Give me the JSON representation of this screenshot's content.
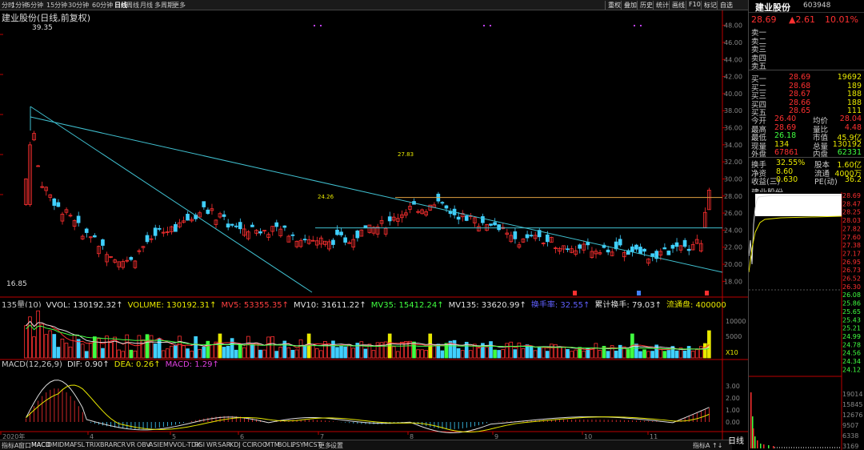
{
  "top_toolbar": {
    "items": [
      "分时",
      "1分钟",
      "5分钟",
      "15分钟",
      "30分钟",
      "60分钟",
      "日线",
      "周线",
      "月线",
      "多周期",
      "更多"
    ],
    "active": "日线",
    "right_items": [
      "重权",
      "叠加",
      "历史",
      "统计",
      "画线",
      "F10",
      "标记",
      "自选"
    ]
  },
  "chart_title": "建业股份(日线,前复权)",
  "main": {
    "high_label": "39.35",
    "low_label": "16.85",
    "price_ticks": [
      "48.00",
      "46.00",
      "44.00",
      "42.00",
      "40.00",
      "38.00",
      "36.00",
      "34.00",
      "32.00",
      "30.00",
      "28.00",
      "26.00",
      "24.00",
      "22.00",
      "20.00",
      "18.00"
    ],
    "annot_high": "27.83",
    "annot_low": "24.26",
    "markers": [
      "3",
      "3",
      "3"
    ]
  },
  "volume": {
    "legend": [
      {
        "t": "135量(10)",
        "c": "#c8c8c8"
      },
      {
        "t": "VVOL: 130192.32↑",
        "c": "#e0e0e0"
      },
      {
        "t": "VOLUME: 130192.31↑",
        "c": "#e8e800"
      },
      {
        "t": "MV5: 53355.35↑",
        "c": "#ff4040"
      },
      {
        "t": "MV10: 31611.22↑",
        "c": "#e0e0e0"
      },
      {
        "t": "MV35: 15412.24↑",
        "c": "#40ff40"
      },
      {
        "t": "MV135: 33620.99↑",
        "c": "#e0e0e0"
      },
      {
        "t": "换手率: 32.55↑",
        "c": "#6060ff"
      },
      {
        "t": "累计换手: 79.03↑",
        "c": "#e0e0e0"
      },
      {
        "t": "流通盘: 40000000.0",
        "c": "#e8e800"
      }
    ],
    "ticks": [
      "10000",
      "5000",
      "X10"
    ]
  },
  "macd": {
    "legend": [
      {
        "t": "MACD(12,26,9)",
        "c": "#c8c8c8"
      },
      {
        "t": "DIF: 0.90↑",
        "c": "#e0e0e0"
      },
      {
        "t": "DEA: 0.26↑",
        "c": "#e8e800"
      },
      {
        "t": "MACD: 1.29↑",
        "c": "#e040e0"
      }
    ],
    "ticks": [
      "3.00",
      "2.00",
      "1.00",
      "0.00"
    ]
  },
  "xaxis": {
    "labels": [
      "2020年",
      "4",
      "5",
      "6",
      "7",
      "8",
      "9",
      "10",
      "11"
    ]
  },
  "bottom_bar": {
    "items": [
      "指标A",
      "窗口",
      "MACD",
      "DMI",
      "DMA",
      "FSL",
      "TRIX",
      "BRAR",
      "CR",
      "VR",
      "OBV",
      "ASI",
      "EMV",
      "VOL-TDX",
      "RSI",
      "WR",
      "SAR",
      "KDJ",
      "CCI",
      "ROC",
      "MTM",
      "BOLL",
      "PSY",
      "MCST",
      "更多",
      "设置"
    ],
    "active": "MACD",
    "right": "指标A ↑↓"
  },
  "quote": {
    "name": "建业股份",
    "code": "603948",
    "price": "28.69",
    "change": "▲2.61",
    "pct": "10.01%",
    "asks": [
      {
        "l": "卖五",
        "p": "",
        "v": ""
      },
      {
        "l": "卖四",
        "p": "",
        "v": ""
      },
      {
        "l": "卖三",
        "p": "",
        "v": ""
      },
      {
        "l": "卖二",
        "p": "",
        "v": ""
      },
      {
        "l": "卖一",
        "p": "",
        "v": ""
      }
    ],
    "bids": [
      {
        "l": "买一",
        "p": "28.69",
        "v": "19692"
      },
      {
        "l": "买二",
        "p": "28.68",
        "v": "189"
      },
      {
        "l": "买三",
        "p": "28.67",
        "v": "188"
      },
      {
        "l": "买四",
        "p": "28.66",
        "v": "188"
      },
      {
        "l": "买五",
        "p": "28.65",
        "v": "111"
      }
    ],
    "stats": [
      [
        "今开",
        "26.40",
        "均价",
        "28.04"
      ],
      [
        "最高",
        "28.69",
        "量比",
        "4.48"
      ],
      [
        "最低",
        "26.18",
        "市值",
        "45.9亿"
      ],
      [
        "现量",
        "134",
        "总量",
        "130192"
      ],
      [
        "外盘",
        "67861",
        "内盘",
        "62331"
      ]
    ],
    "stats2": [
      [
        "换手",
        "32.55%",
        "股本",
        "1.60亿"
      ],
      [
        "净资",
        "8.60",
        "流通",
        "4000万"
      ],
      [
        "收益(三)",
        "0.630",
        "PE(动)",
        "36.2"
      ]
    ]
  },
  "intraday": {
    "name": "建业股份",
    "price_ticks": [
      "28.69",
      "28.47",
      "28.25",
      "28.03",
      "27.82",
      "27.60",
      "27.38",
      "27.17",
      "26.95",
      "26.73",
      "26.52",
      "26.30",
      "26.08",
      "25.86",
      "25.65",
      "25.43",
      "25.21",
      "24.99",
      "24.78",
      "24.56",
      "24.34",
      "24.12"
    ],
    "vol_ticks": [
      "19014",
      "15845",
      "12676",
      "9507",
      "6338",
      "3169"
    ],
    "tab": "日线"
  },
  "chart_data": {
    "type": "candlestick",
    "title": "建业股份(日线,前复权)",
    "x": [
      "2020-03",
      "2020-04",
      "2020-05",
      "2020-06",
      "2020-07",
      "2020-08",
      "2020-09",
      "2020-10",
      "2020-11"
    ],
    "high": 39.35,
    "low": 16.85,
    "ylim": [
      17,
      49
    ],
    "last_close": 28.69,
    "key_levels": [
      27.83,
      24.26
    ]
  }
}
